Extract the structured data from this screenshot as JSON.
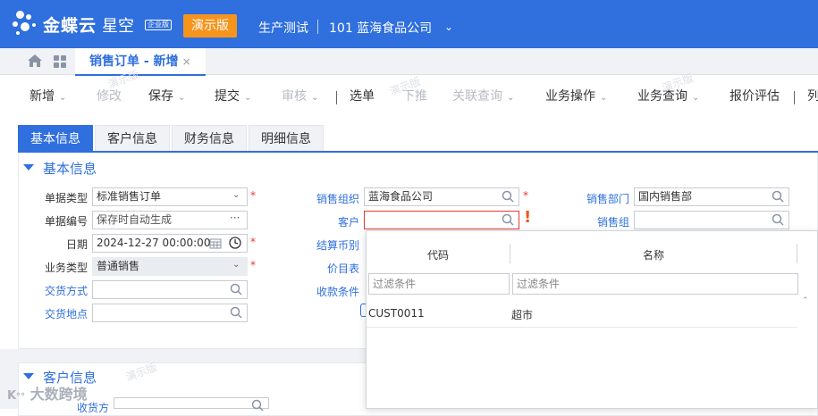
{
  "header": {
    "brand": "金蝶云",
    "brand_sub": "星空",
    "edition_badge": "企业版",
    "demo_label": "演示版",
    "environment": "生产测试",
    "company": "101 蓝海食品公司",
    "accent": "#2f6fde",
    "demo_color": "#f7941d"
  },
  "tabs": {
    "doc_tab": "销售订单 - 新增",
    "close": "×"
  },
  "toolbar": {
    "new": "新增",
    "modify": "修改",
    "save": "保存",
    "submit": "提交",
    "audit": "审核",
    "select_order": "选单",
    "push_down": "下推",
    "related_query": "关联查询",
    "business_ops": "业务操作",
    "business_query": "业务查询",
    "quote_eval": "报价评估",
    "cut": "列"
  },
  "section_tabs": [
    "基本信息",
    "客户信息",
    "财务信息",
    "明细信息"
  ],
  "basic": {
    "title": "基本信息",
    "doc_type_label": "单据类型",
    "doc_type_value": "标准销售订单",
    "doc_no_label": "单据编号",
    "doc_no_placeholder": "保存时自动生成",
    "date_label": "日期",
    "date_value": "2024-12-27 00:00:00",
    "biz_type_label": "业务类型",
    "biz_type_value": "普通销售",
    "delivery_method_label": "交货方式",
    "delivery_place_label": "交货地点",
    "sales_org_label": "销售组织",
    "sales_org_value": "蓝海食品公司",
    "customer_label": "客户",
    "currency_label": "结算币别",
    "price_list_label": "价目表",
    "payment_terms_label": "收款条件",
    "sales_dept_label": "销售部门",
    "sales_dept_value": "国内销售部",
    "sales_group_label": "销售组",
    "required_mark": "*",
    "error_mark": "!"
  },
  "customer_section": {
    "title": "客户信息",
    "receiver_label": "收货方"
  },
  "lookup": {
    "col_code": "代码",
    "col_name": "名称",
    "filter_placeholder": "过滤条件",
    "rows": [
      {
        "code": "CUST0011",
        "name": "超市"
      }
    ]
  },
  "watermark": "演示版",
  "footer_logo": "大数跨境"
}
